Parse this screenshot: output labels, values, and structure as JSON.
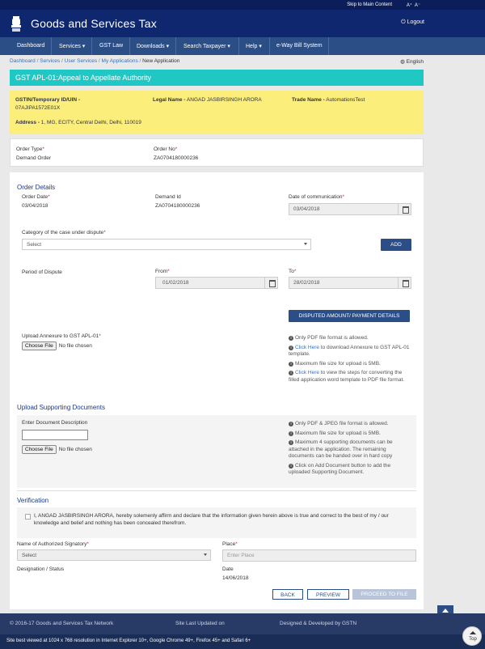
{
  "top": {
    "skip": "Skip to Main Content",
    "font_a_plus": "A⁺",
    "font_a_minus": "A⁻"
  },
  "header": {
    "title": "Goods and Services Tax",
    "logout": "Logout"
  },
  "nav": [
    {
      "label": "Dashboard"
    },
    {
      "label": "Services ▾"
    },
    {
      "label": "GST Law"
    },
    {
      "label": "Downloads ▾"
    },
    {
      "label": "Search Taxpayer ▾"
    },
    {
      "label": "Help ▾"
    },
    {
      "label": "e-Way Bill System"
    }
  ],
  "breadcrumb": {
    "c1": "Dashboard",
    "c2": "Services",
    "c3": "User Services",
    "c4": "My Applications",
    "current": "New Application",
    "sep": "/",
    "lang": "English"
  },
  "panel": {
    "title": "GST APL-01:Appeal to Appellate Authority"
  },
  "taxpayer": {
    "gstin_label": "GSTIN/Temporary ID/UIN -",
    "gstin_value": "07AJIPA1572E01X",
    "legal_label": "Legal Name -",
    "legal_value": "ANGAD JASBIRSINGH ARORA",
    "trade_label": "Trade Name -",
    "trade_value": "AutomationsTest",
    "address_label": "Address -",
    "address_value": "1, MG, ECITY, Central Delhi, Delhi, 110019"
  },
  "order": {
    "type_label": "Order Type",
    "type_value": "Demand Order",
    "no_label": "Order No",
    "no_value": "ZA0704180000236"
  },
  "details": {
    "heading": "Order Details",
    "date_label": "Order Date",
    "date_value": "03/04/2018",
    "demand_label": "Demand Id",
    "demand_value": "ZA0704180000236",
    "comm_label": "Date of communication",
    "comm_value": "03/04/2018",
    "category_label": "Category of the case under dispute",
    "category_value": "Select",
    "add_button": "ADD",
    "period_label": "Period of Dispute",
    "from_label": "From",
    "from_value": "01/02/2018",
    "to_label": "To",
    "to_value": "28/02/2018",
    "disputed_button": "DISPUTED AMOUNT/ PAYMENT DETAILS",
    "annexure_label": "Upload Annexure to GST APL-01",
    "choose_file": "Choose File",
    "no_file": "No file chosen",
    "info1": "Only PDF file format is allowed.",
    "info2_link": "Click Here",
    "info2_rest": " to download Annexure to GST APL-01 template.",
    "info3": "Maximum file size for upload is 5MB.",
    "info4_link": "Click Here",
    "info4_rest": " to view the steps for converting the filled application word template to PDF file format."
  },
  "supporting": {
    "heading": "Upload Supporting Documents",
    "desc_label": "Enter Document Description",
    "choose_file": "Choose File",
    "no_file": "No file chosen",
    "info1": "Only PDF & JPEG file format is allowed.",
    "info2": "Maximum file size for upload is 5MB.",
    "info3": "Maximum 4 supporting documents can be attached in the application. The remaining documents can be handed over in hard copy",
    "info4": "Click on Add Document button to add the uploaded Supporting Document."
  },
  "verification": {
    "heading": "Verification",
    "declaration": "I, ANGAD JASBIRSINGH ARORA, hereby solemenly affirm and declare that the information given herein above is true and correct to the best of my / our knowledge and belief and nothing has been concealed therefrom.",
    "signatory_label": "Name of Authorized Signatory",
    "signatory_value": "Select",
    "place_label": "Place",
    "place_placeholder": "Enter Place",
    "designation_label": "Designation / Status",
    "date_label": "Date",
    "date_value": "14/06/2018"
  },
  "actions": {
    "back": "BACK",
    "preview": "PREVIEW",
    "proceed": "PROCEED TO FILE"
  },
  "footer": {
    "copyright": "© 2016-17 Goods and Services Tax Network",
    "updated": "Site Last Updated on",
    "designed": "Designed & Developed by GSTN",
    "best_viewed": "Site best viewed at 1024 x 768 resolution in Internet Explorer 10+, Google Chrome 49+, Firefox 45+ and Safari 6+",
    "top_label": "Top"
  },
  "colors": {
    "header": "#0e276f",
    "nav": "#2c4e86",
    "title_bar": "#1fc8c4",
    "info_box": "#fbee7a",
    "required": "#c0392b"
  }
}
